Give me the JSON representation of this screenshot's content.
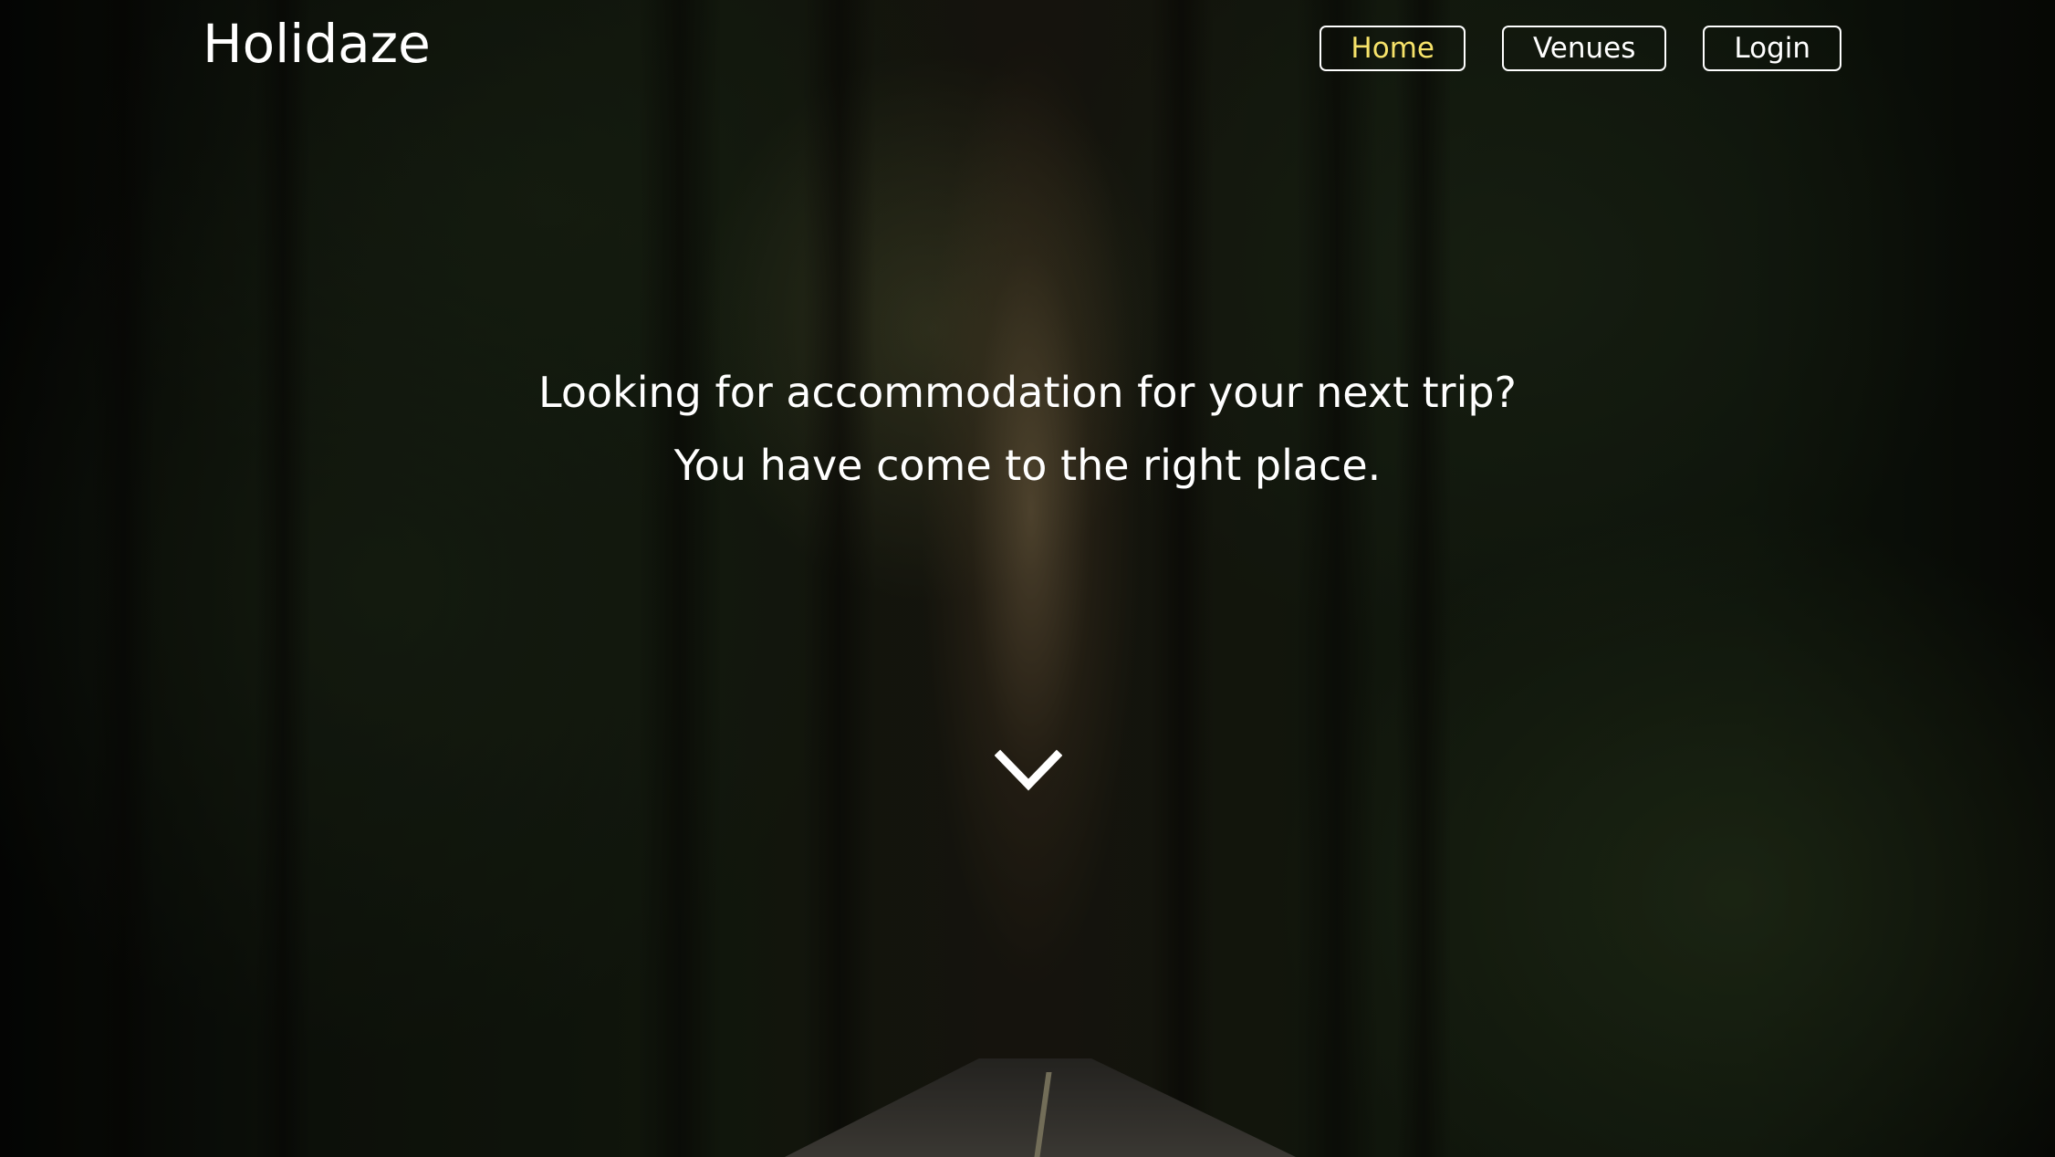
{
  "header": {
    "logo": "Holidaze",
    "nav": [
      {
        "label": "Home",
        "active": true
      },
      {
        "label": "Venues",
        "active": false
      },
      {
        "label": "Login",
        "active": false
      }
    ]
  },
  "hero": {
    "line1": "Looking for accommodation for your next trip?",
    "line2": "You have come to the right place.",
    "scroll_icon": "chevron-down-icon"
  },
  "colors": {
    "text": "#ffffff",
    "active_nav": "#f7e36a"
  }
}
